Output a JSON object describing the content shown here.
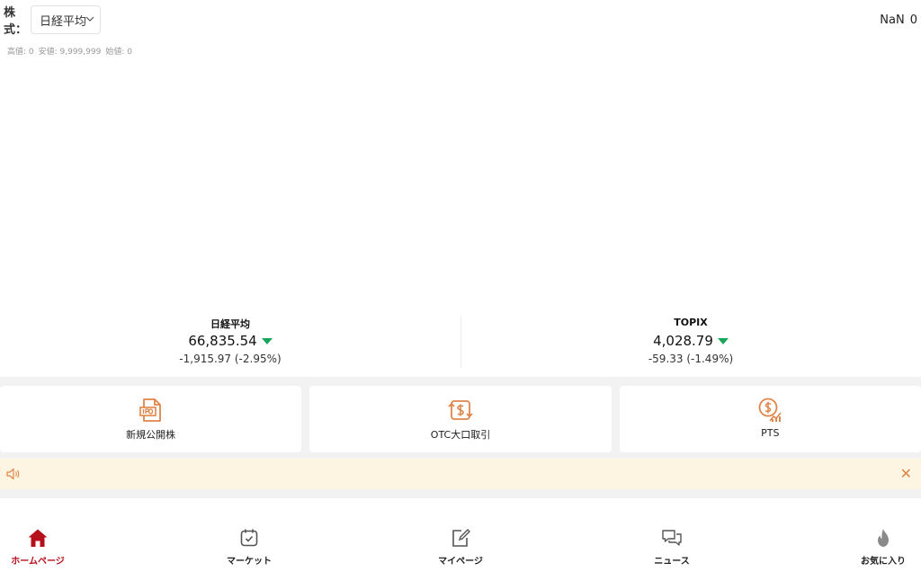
{
  "header": {
    "stock_label": "株式：",
    "selected_index": "日経平均",
    "readout": {
      "first": "NaN",
      "second": "0"
    },
    "range": {
      "high": "高値: 0",
      "low": "安値: 9,999,999",
      "open": "始値: 0"
    }
  },
  "indices": [
    {
      "name": "日経平均",
      "value": "66,835.54",
      "change": "-1,915.97 (-2.95%)",
      "direction": "down"
    },
    {
      "name": "TOPIX",
      "value": "4,028.79",
      "change": "-59.33 (-1.49%)",
      "direction": "down"
    }
  ],
  "tiles": [
    {
      "label": "新規公開株",
      "icon": "ipo-document-icon"
    },
    {
      "label": "OTC大口取引",
      "icon": "dollar-exchange-icon"
    },
    {
      "label": "PTS",
      "icon": "dollar-chart-icon"
    }
  ],
  "nav": [
    {
      "label": "ホームページ",
      "icon": "home-icon",
      "active": true
    },
    {
      "label": "マーケット",
      "icon": "calendar-check-icon",
      "active": false
    },
    {
      "label": "マイページ",
      "icon": "edit-icon",
      "active": false
    },
    {
      "label": "ニュース",
      "icon": "chat-bubbles-icon",
      "active": false
    },
    {
      "label": "お気に入り",
      "icon": "flame-icon",
      "active": false
    }
  ],
  "colors": {
    "accent": "#e0854a",
    "active": "#b5101b",
    "down": "#1aa55c",
    "notice_bg": "#fdf5e2",
    "band": "#f2f2f2"
  }
}
